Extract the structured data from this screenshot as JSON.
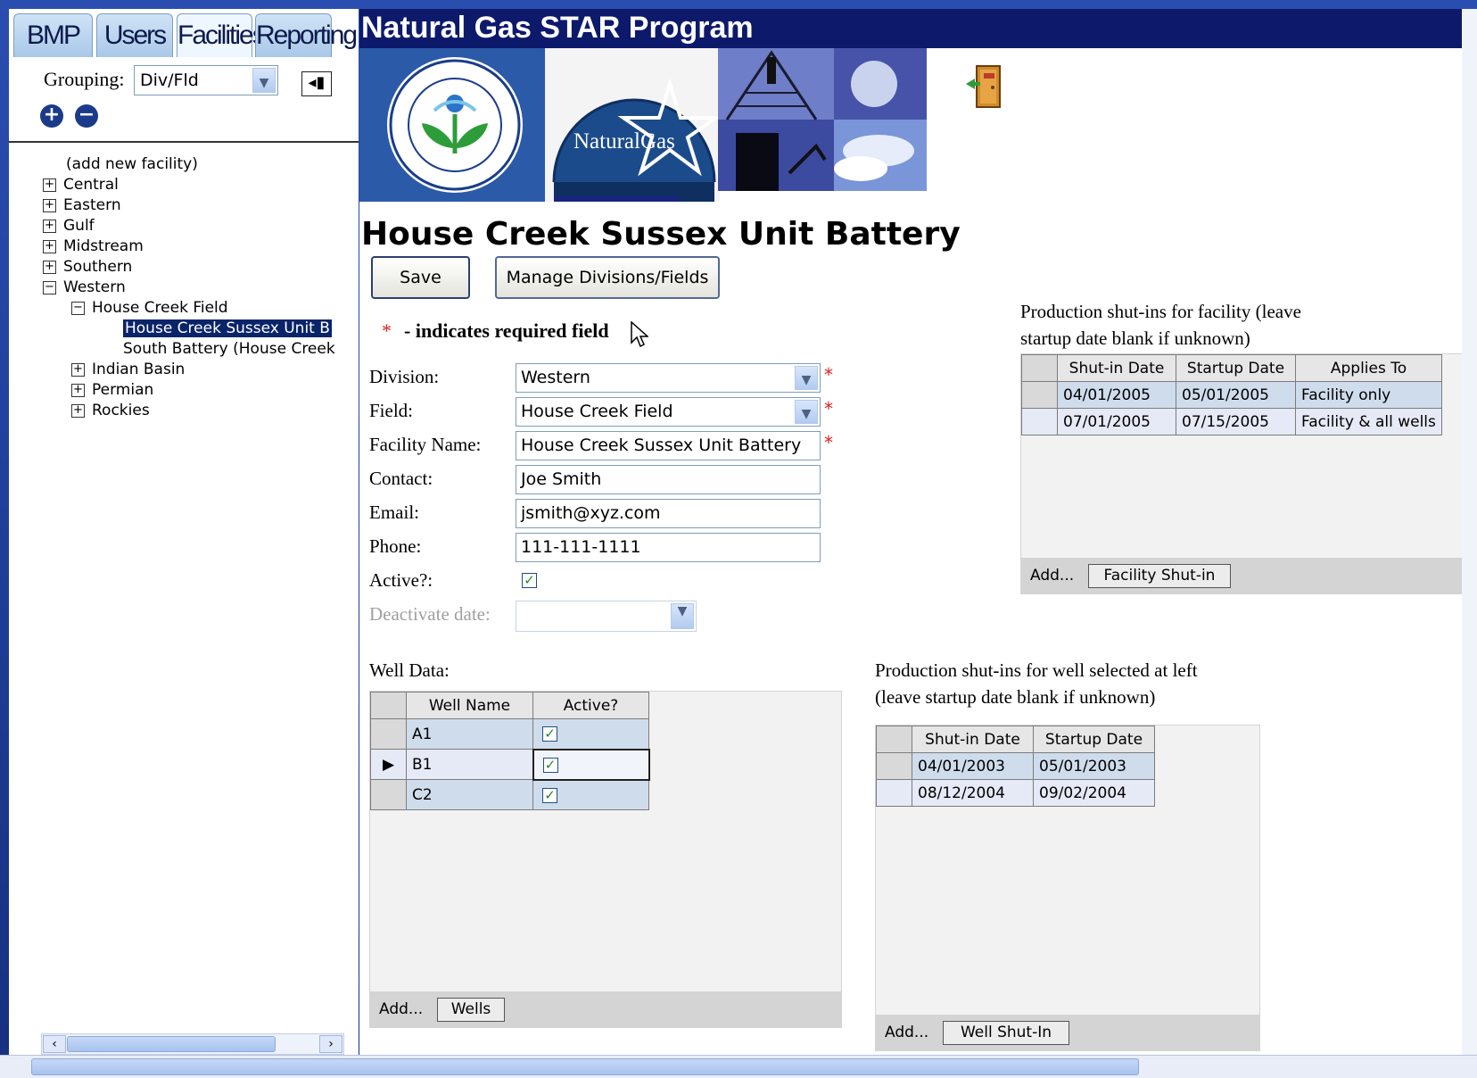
{
  "tabs": [
    {
      "label": "BMP"
    },
    {
      "label": "Users"
    },
    {
      "label": "Facilities"
    },
    {
      "label": "Reporting"
    }
  ],
  "grouping": {
    "label": "Grouping:",
    "value": "Div/Fld"
  },
  "tree": {
    "add_new": "(add new facility)",
    "items": [
      {
        "label": "Central"
      },
      {
        "label": "Eastern"
      },
      {
        "label": "Gulf"
      },
      {
        "label": "Midstream"
      },
      {
        "label": "Southern"
      },
      {
        "label": "Western"
      },
      {
        "label": "House Creek Field"
      },
      {
        "label": "House Creek Sussex Unit B"
      },
      {
        "label": "South Battery (House Creek"
      },
      {
        "label": "Indian Basin"
      },
      {
        "label": "Permian"
      },
      {
        "label": "Rockies"
      }
    ]
  },
  "banner": {
    "title": "Natural Gas STAR Program",
    "logo_text": "NaturalGas"
  },
  "page_title": "House Creek Sussex Unit Battery",
  "buttons": {
    "save": "Save",
    "manage": "Manage Divisions/Fields"
  },
  "required_note": {
    "star": "*",
    "text": "- indicates required field"
  },
  "form": {
    "division": {
      "label": "Division:",
      "value": "Western"
    },
    "field": {
      "label": "Field:",
      "value": "House Creek Field"
    },
    "facility_name": {
      "label": "Facility Name:",
      "value": "House Creek Sussex Unit Battery"
    },
    "contact": {
      "label": "Contact:",
      "value": "Joe Smith"
    },
    "email": {
      "label": "Email:",
      "value": "jsmith@xyz.com"
    },
    "phone": {
      "label": "Phone:",
      "value": "111-111-1111"
    },
    "active": {
      "label": "Active?:",
      "checked": true
    },
    "deactivate": {
      "label": "Deactivate date:",
      "value": ""
    }
  },
  "facility_shutins": {
    "caption_line1": "Production shut-ins for facility (leave",
    "caption_line2": "startup date blank if unknown)",
    "headers": [
      "Shut-in Date",
      "Startup Date",
      "Applies To"
    ],
    "rows": [
      [
        "04/01/2005",
        "05/01/2005",
        "Facility only"
      ],
      [
        "07/01/2005",
        "07/15/2005",
        "Facility & all wells"
      ]
    ],
    "add_label": "Add...",
    "add_button": "Facility Shut-in"
  },
  "wells": {
    "caption": "Well Data:",
    "headers": [
      "Well Name",
      "Active?"
    ],
    "rows": [
      {
        "name": "A1",
        "active": true
      },
      {
        "name": "B1",
        "active": true
      },
      {
        "name": "C2",
        "active": true
      }
    ],
    "add_label": "Add...",
    "add_button": "Wells"
  },
  "well_shutins": {
    "caption_line1": "Production shut-ins for well selected at left",
    "caption_line2": "(leave startup date blank if unknown)",
    "headers": [
      "Shut-in Date",
      "Startup Date"
    ],
    "rows": [
      [
        "04/01/2003",
        "05/01/2003"
      ],
      [
        "08/12/2004",
        "09/02/2004"
      ]
    ],
    "add_label": "Add...",
    "add_button": "Well Shut-In"
  },
  "colors": {
    "banner": "#0d1a6b",
    "selection": "#0a246a",
    "required": "#e02020"
  }
}
